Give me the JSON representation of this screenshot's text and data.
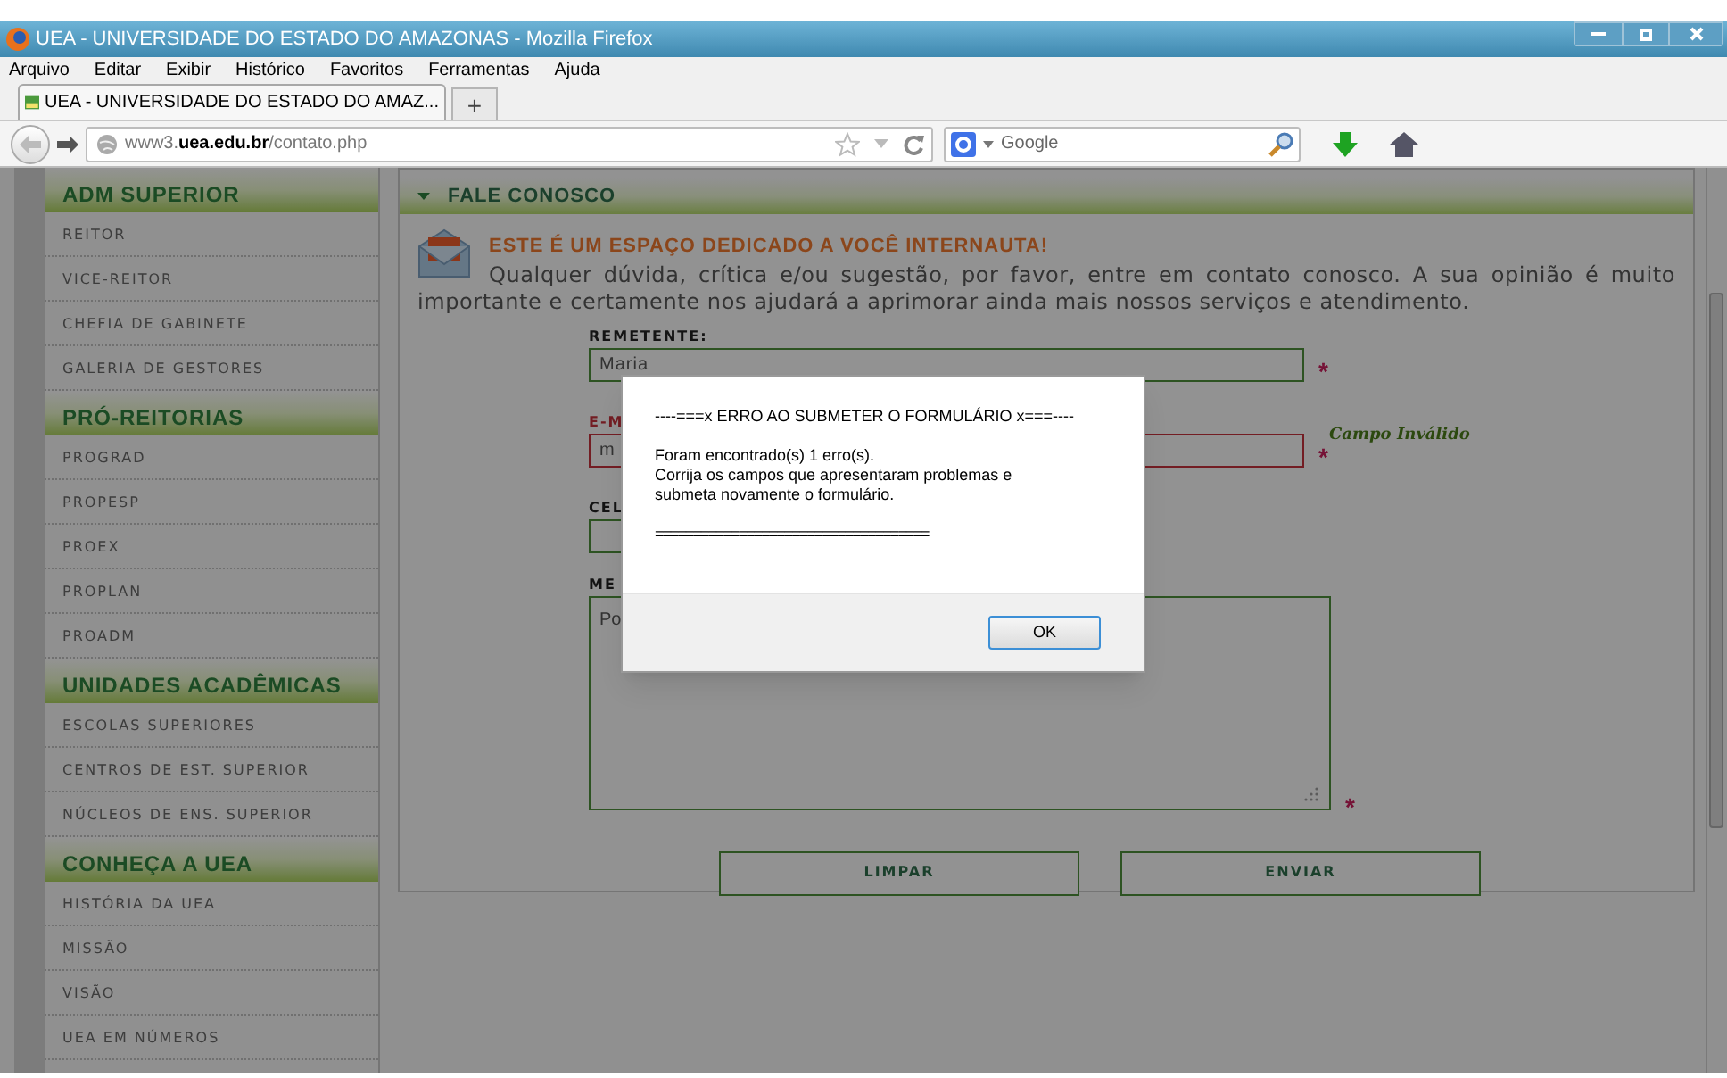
{
  "window": {
    "title": "UEA - UNIVERSIDADE DO ESTADO DO AMAZONAS - Mozilla Firefox"
  },
  "menu": [
    "Arquivo",
    "Editar",
    "Exibir",
    "Histórico",
    "Favoritos",
    "Ferramentas",
    "Ajuda"
  ],
  "tabs": [
    {
      "label": "UEA - UNIVERSIDADE DO ESTADO DO AMAZ...",
      "selected": true
    }
  ],
  "new_tab": "+",
  "address": {
    "url": "www3.**uea.edu.br**/contato.php"
  },
  "search": {
    "placeholder": "Google"
  },
  "sidebar": {
    "sections": [
      {
        "title": "ADM SUPERIOR",
        "items": [
          "REITOR",
          "VICE-REITOR",
          "CHEFIA DE GABINETE",
          "GALERIA DE GESTORES"
        ]
      },
      {
        "title": "PRÓ-REITORIAS",
        "items": [
          "PROGRAD",
          "PROPESP",
          "PROEX",
          "PROPLAN",
          "PROADM"
        ]
      },
      {
        "title": "UNIDADES ACADÊMICAS",
        "items": [
          "ESCOLAS SUPERIORES",
          "CENTROS DE EST. SUPERIOR",
          "NÚCLEOS DE ENS. SUPERIOR"
        ]
      },
      {
        "title": "CONHEÇA A UEA",
        "items": [
          "HISTÓRIA DA UEA",
          "MISSÃO",
          "VISÃO",
          "UEA EM NÚMEROS"
        ]
      }
    ]
  },
  "main": {
    "header": "FALE CONOSCO",
    "intro_title": "ESTE É UM ESPAÇO DEDICADO A VOCÊ INTERNAUTA!",
    "intro_text": "Qualquer dúvida, crítica e/ou sugestão, por favor, entre em contato conosco. A sua opinião é muito importante e certamente nos ajudará a aprimorar ainda mais nossos serviços e atendimento.",
    "fields": [
      {
        "kind": "input",
        "label": "REMETENTE:",
        "value": "Maria",
        "marker": "*",
        "invalid": false
      },
      {
        "kind": "input",
        "label": "E-M",
        "value": "m",
        "marker": "*",
        "invalid": true,
        "error": "Campo Inválido"
      },
      {
        "kind": "short",
        "label": "CEL",
        "invalid": false
      },
      {
        "kind": "textarea",
        "label": "ME",
        "value": "Po",
        "marker": "*",
        "invalid": false
      }
    ],
    "buttons": [
      "LIMPAR",
      "ENVIAR"
    ]
  },
  "dialog": {
    "title": "----===x ERRO AO SUBMETER O FORMULÁRIO x===----",
    "lines": [
      "Foram encontrado(s) 1 erro(s).",
      "Corrija os campos que apresentaram problemas e submeta novamente o formulário."
    ],
    "rule": "====================================",
    "ok": "OK"
  }
}
